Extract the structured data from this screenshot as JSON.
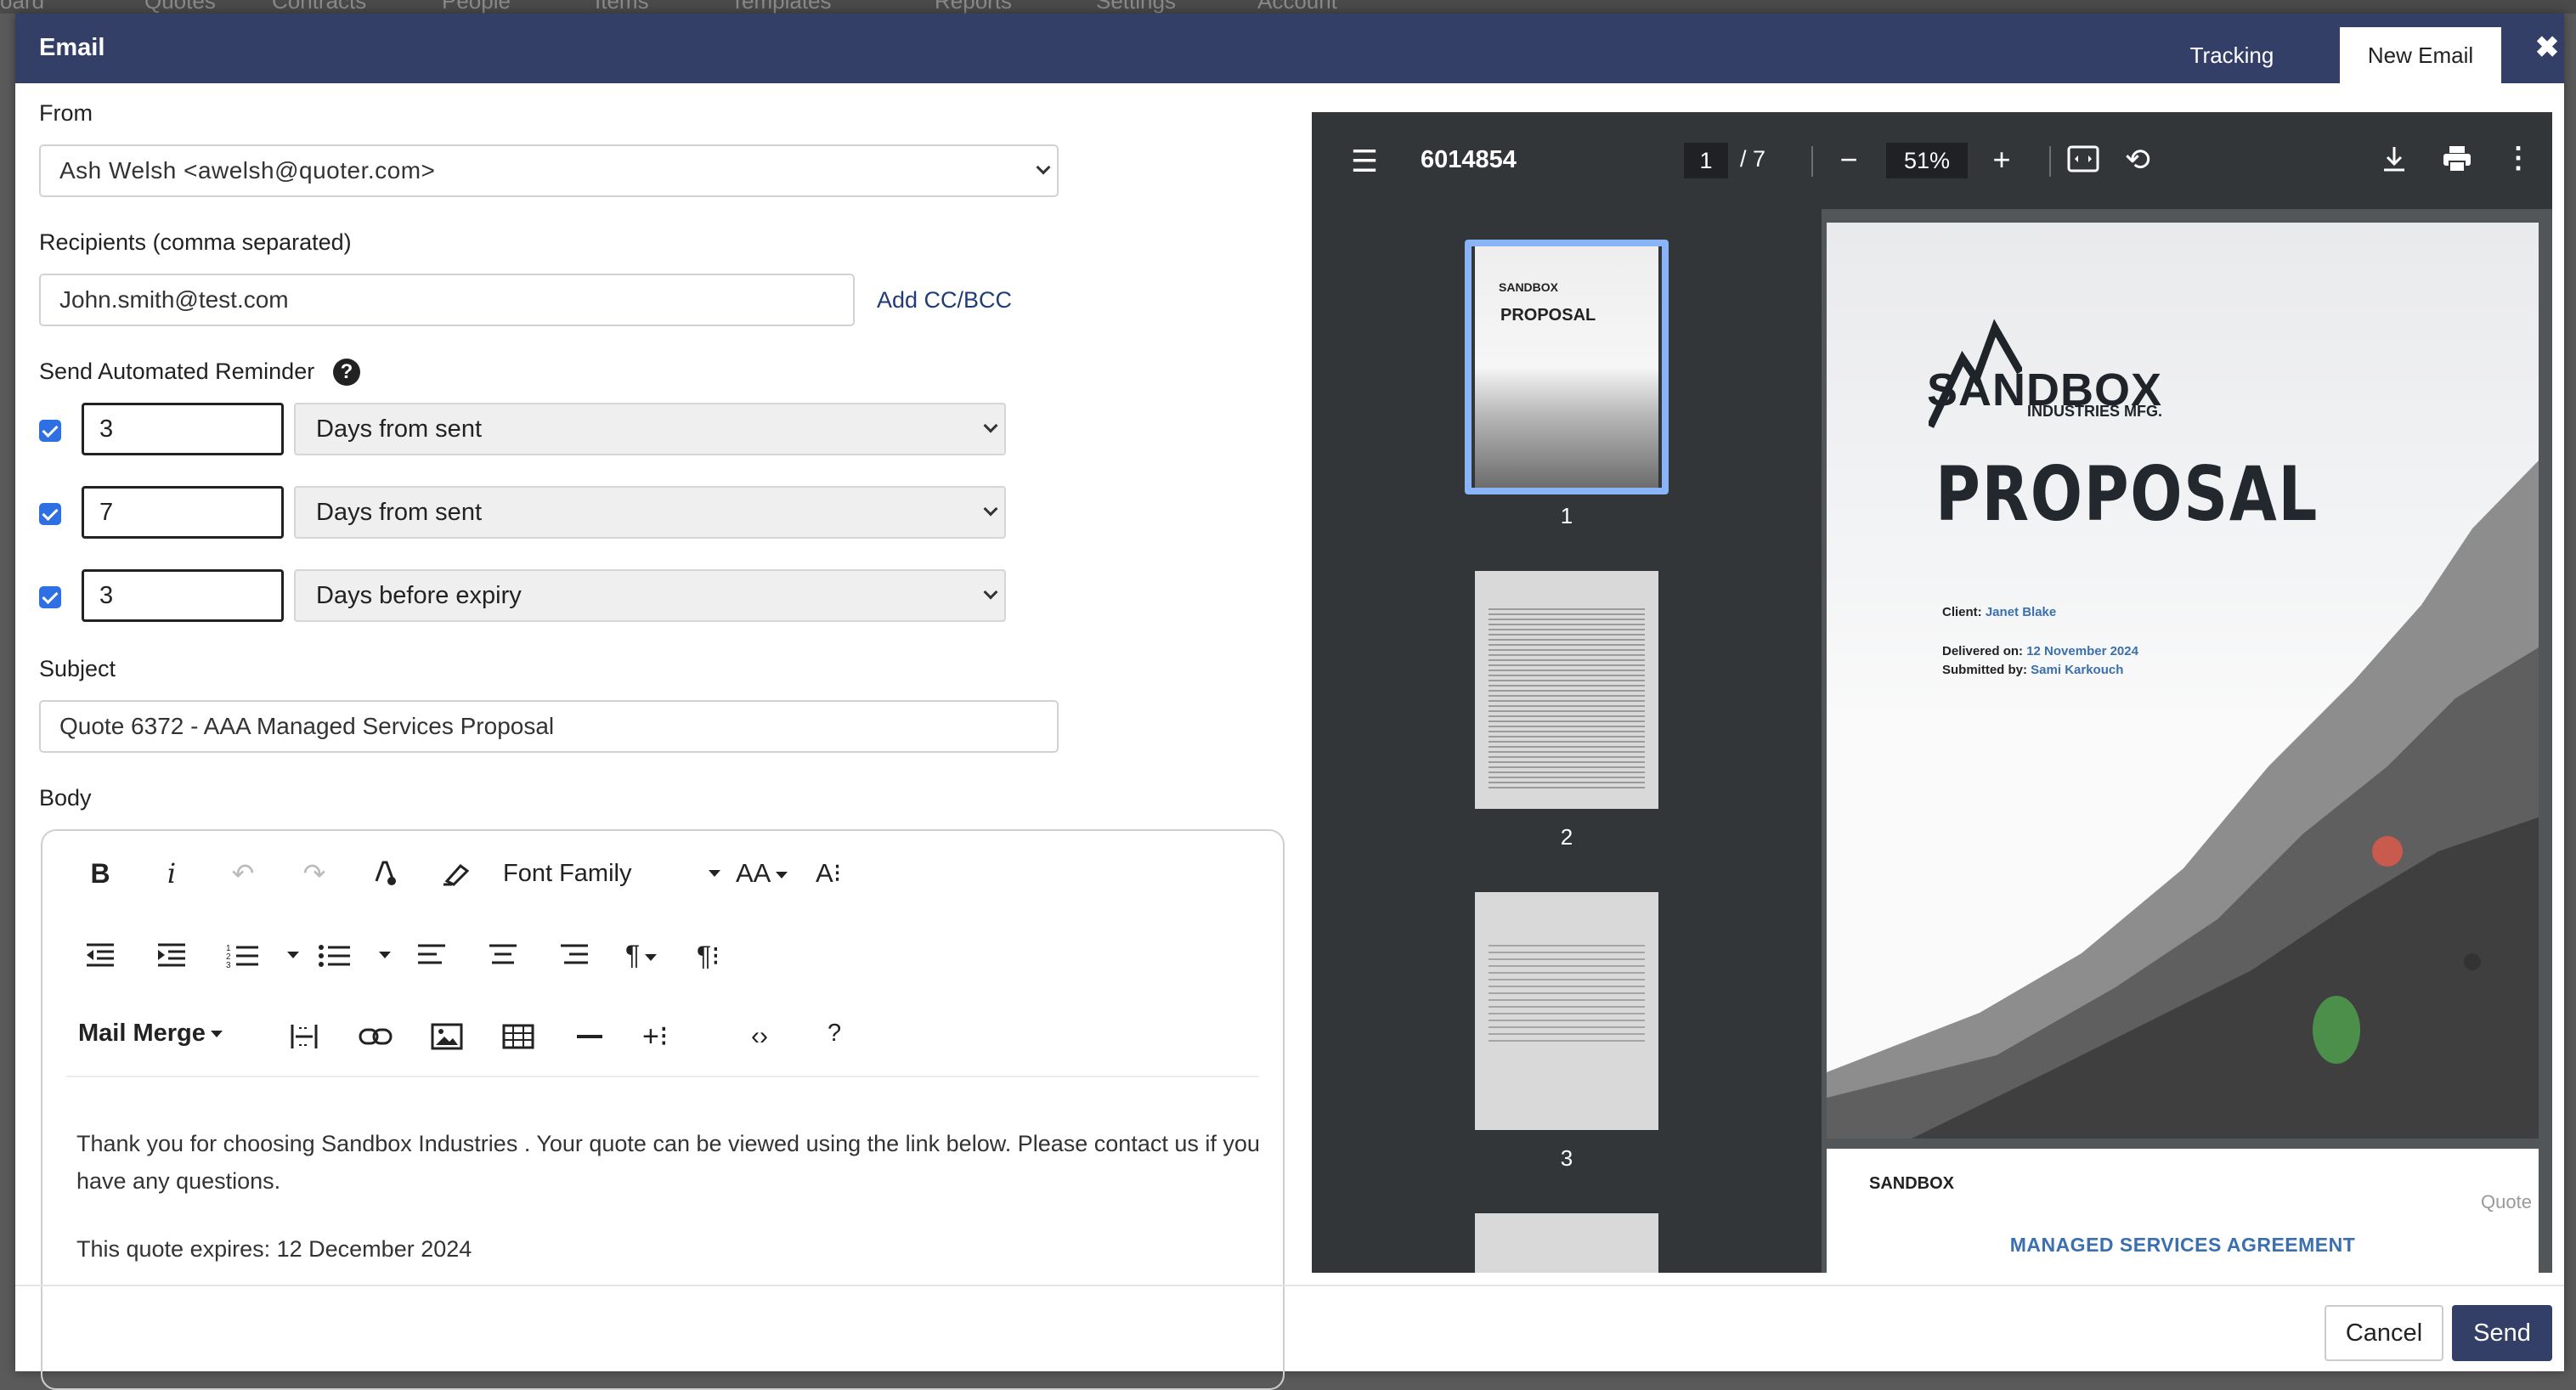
{
  "background_nav": [
    "oard",
    "Quotes",
    "Contracts",
    "People",
    "Items",
    "Templates",
    "Reports",
    "Settings",
    "Account"
  ],
  "modal": {
    "title": "Email",
    "tabs": [
      {
        "label": "Tracking",
        "active": false
      },
      {
        "label": "New Email",
        "active": true
      }
    ],
    "close_icon": "close-icon"
  },
  "form": {
    "from_label": "From",
    "from_value": "Ash Welsh <awelsh@quoter.com>",
    "recipients_label": "Recipients (comma separated)",
    "recipients_value": "John.smith@test.com",
    "add_cc_bcc": "Add CC/BCC",
    "reminder_label": "Send Automated Reminder",
    "reminders": [
      {
        "checked": true,
        "days": "3",
        "type": "Days from sent"
      },
      {
        "checked": true,
        "days": "7",
        "type": "Days from sent"
      },
      {
        "checked": true,
        "days": "3",
        "type": "Days before expiry"
      }
    ],
    "subject_label": "Subject",
    "subject_value": "Quote 6372 - AAA Managed Services Proposal",
    "body_label": "Body"
  },
  "editor": {
    "font_family": "Font Family",
    "mail_merge": "Mail Merge",
    "help": "?",
    "body_paragraph_1": "Thank you for choosing Sandbox Industries . Your quote can be viewed using the link below. Please contact us if you have any questions.",
    "body_paragraph_2": "This quote expires: 12 December 2024"
  },
  "pdf": {
    "title": "6014854",
    "current_page": "1",
    "total_pages": "/ 7",
    "zoom": "51%",
    "thumbnails": [
      "1",
      "2",
      "3"
    ],
    "page1": {
      "brand": "SANDBOX",
      "brand_sub": "INDUSTRIES MFG.",
      "heading": "PROPOSAL",
      "client_label": "Client:",
      "client": "Janet Blake",
      "delivered_label": "Delivered on:",
      "delivered": "12 November 2024",
      "submitted_label": "Submitted by:",
      "submitted": "Sami Karkouch"
    },
    "page2": {
      "logo": "SANDBOX",
      "quote_label": "Quote",
      "title": "MANAGED SERVICES AGREEMENT"
    }
  },
  "footer": {
    "cancel": "Cancel",
    "send": "Send"
  },
  "colors": {
    "header": "#343f68",
    "accent_link": "#1f3c7a",
    "checkbox": "#2f6fe4",
    "pdf_toolbar": "#323639"
  }
}
